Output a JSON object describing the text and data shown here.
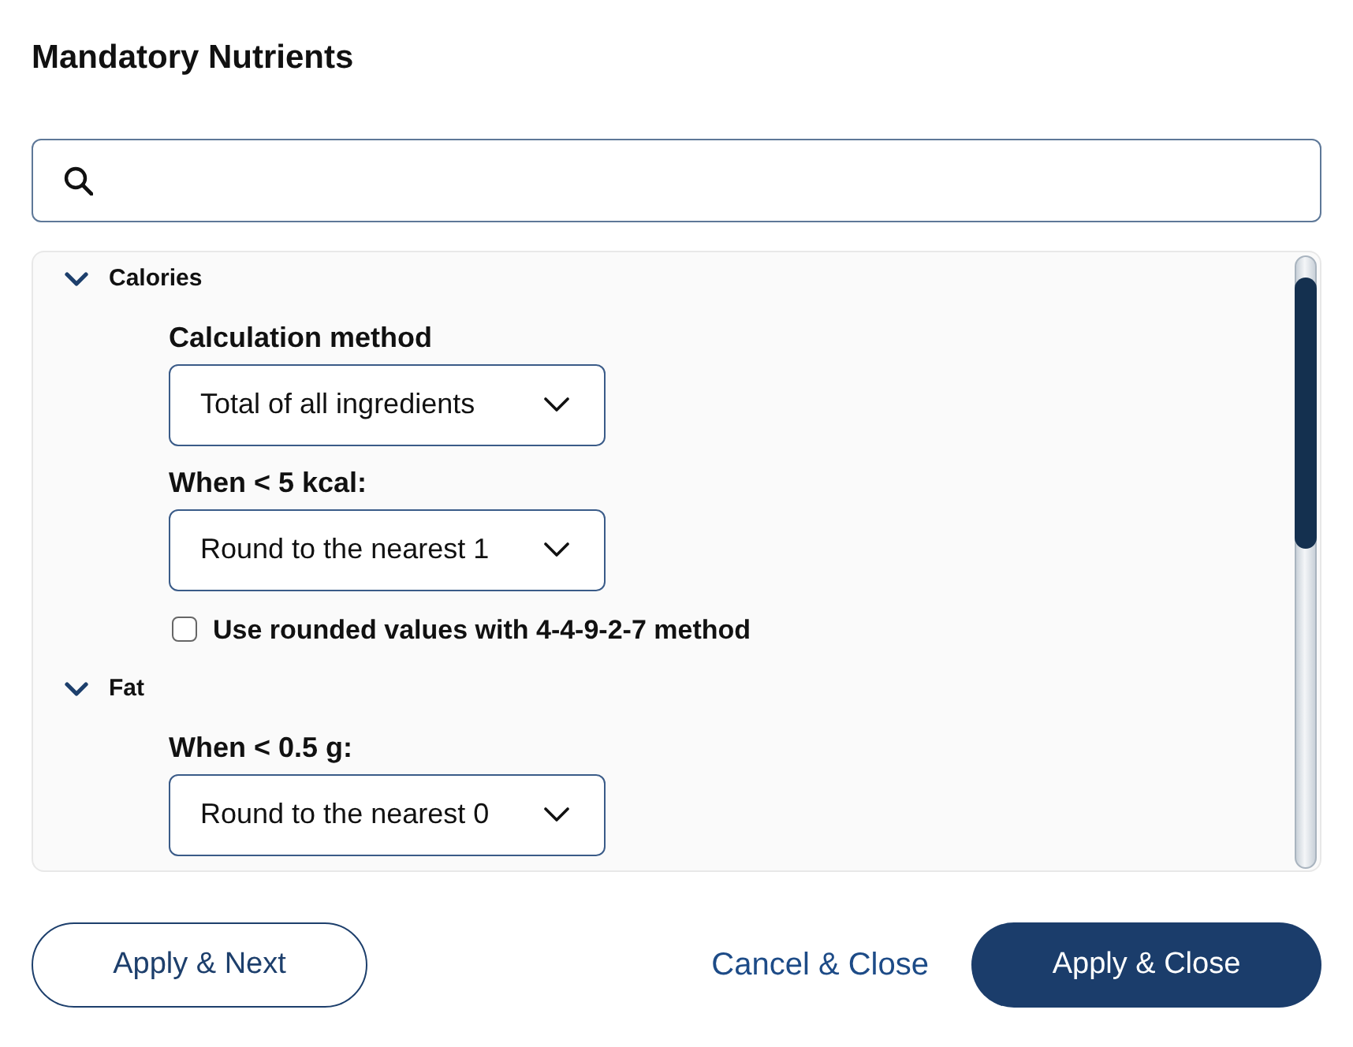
{
  "dialog": {
    "title": "Mandatory Nutrients"
  },
  "sections": [
    {
      "title": "Calories",
      "expanded": true,
      "fields": [
        {
          "kind": "select",
          "label": "Calculation method",
          "value": "Total of all ingredients"
        },
        {
          "kind": "select",
          "label": "When < 5 kcal:",
          "value": "Round to the nearest 1"
        },
        {
          "kind": "checkbox",
          "label": "Use rounded values with 4-4-9-2-7 method",
          "checked": false
        }
      ]
    },
    {
      "title": "Fat",
      "expanded": true,
      "fields": [
        {
          "kind": "select",
          "label": "When < 0.5 g:",
          "value": "Round to the nearest 0"
        }
      ]
    }
  ],
  "buttons": [
    {
      "kind": "outline",
      "label": "Apply & Next"
    },
    {
      "kind": "link",
      "label": "Cancel & Close"
    },
    {
      "kind": "primary",
      "label": "Apply & Close"
    }
  ]
}
